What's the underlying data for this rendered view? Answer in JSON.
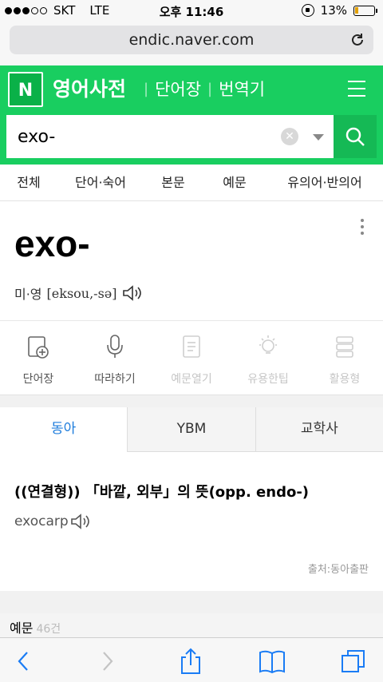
{
  "status_bar": {
    "carrier": "SKT",
    "network": "LTE",
    "time": "오후 11:46",
    "battery": "13%"
  },
  "browser": {
    "url": "endic.naver.com"
  },
  "header": {
    "logo": "N",
    "title": "영어사전",
    "links": [
      "단어장",
      "번역기"
    ]
  },
  "search": {
    "value": "exo-"
  },
  "tabs": [
    "전체",
    "단어·숙어",
    "본문",
    "예문",
    "유의어·반의어"
  ],
  "entry": {
    "word": "exo-",
    "pron_label": "미·영",
    "ipa": "[eksou,-sə]"
  },
  "actions": [
    {
      "label": "단어장",
      "icon": "wordbook-add-icon",
      "enabled": true
    },
    {
      "label": "따라하기",
      "icon": "microphone-icon",
      "enabled": true
    },
    {
      "label": "예문열기",
      "icon": "document-icon",
      "enabled": false
    },
    {
      "label": "유용한팁",
      "icon": "lightbulb-icon",
      "enabled": false
    },
    {
      "label": "활용형",
      "icon": "stack-icon",
      "enabled": false
    }
  ],
  "dict_tabs": [
    "동아",
    "YBM",
    "교학사"
  ],
  "meaning": {
    "definition": "((연결형)) 「바깥, 외부」의 뜻(opp. endo-)",
    "related": "exocarp",
    "source": "출처:동아출판"
  },
  "examples": {
    "label": "예문",
    "count": "46건"
  },
  "colors": {
    "brand": "#19ce60",
    "active_tab": "#1d7cdc",
    "ios_blue": "#1a7cf5"
  }
}
